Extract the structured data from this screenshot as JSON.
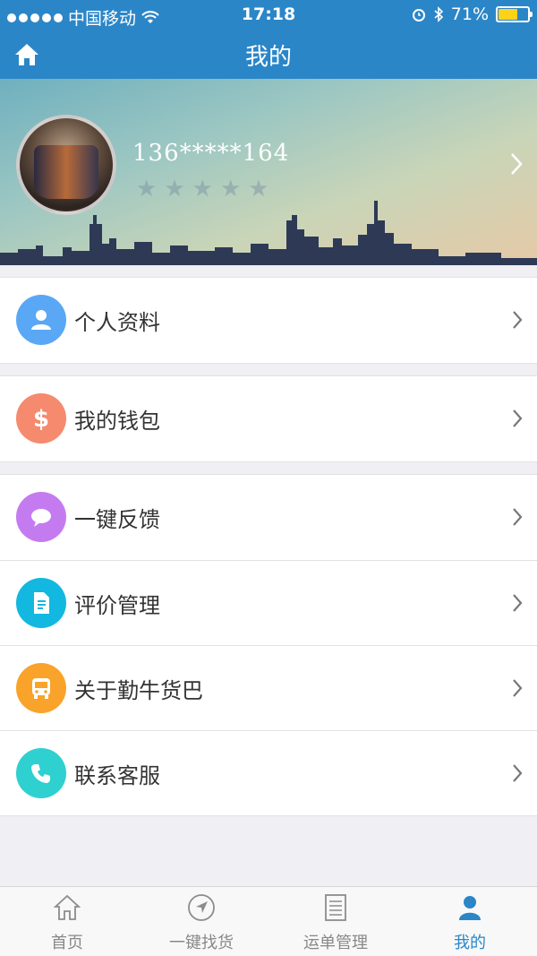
{
  "status_bar": {
    "carrier": "中国移动",
    "time": "17:18",
    "battery_percent": "71%",
    "battery_level": 0.71
  },
  "nav": {
    "title": "我的"
  },
  "profile": {
    "phone": "136*****164",
    "rating_stars_total": 5,
    "rating_stars_filled": 0
  },
  "menu_groups": [
    [
      {
        "label": "个人资料",
        "icon": "person-icon",
        "color": "#5aa7f5"
      }
    ],
    [
      {
        "label": "我的钱包",
        "icon": "dollar-icon",
        "color": "#f58a6e"
      }
    ],
    [
      {
        "label": "一键反馈",
        "icon": "chat-bubble-icon",
        "color": "#c57bf0"
      },
      {
        "label": "评价管理",
        "icon": "document-icon",
        "color": "#12b8e0"
      },
      {
        "label": "关于勤牛货巴",
        "icon": "bus-icon",
        "color": "#f9a32a"
      },
      {
        "label": "联系客服",
        "icon": "phone-icon",
        "color": "#2fd0d0"
      }
    ]
  ],
  "tabs": [
    {
      "label": "首页",
      "icon": "home-icon",
      "active": false
    },
    {
      "label": "一键找货",
      "icon": "compass-arrow-icon",
      "active": false
    },
    {
      "label": "运单管理",
      "icon": "list-document-icon",
      "active": false
    },
    {
      "label": "我的",
      "icon": "user-icon",
      "active": true
    }
  ],
  "colors": {
    "brand": "#2b86c8",
    "background": "#efeff4",
    "battery_fill": "#ffd21a"
  }
}
